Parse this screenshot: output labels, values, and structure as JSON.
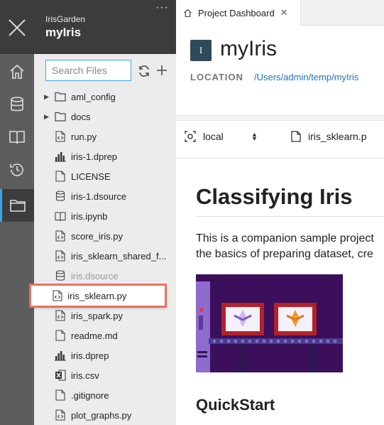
{
  "project": {
    "workspace": "IrisGarden",
    "name": "myIris",
    "more": "···"
  },
  "rail": [
    {
      "name": "home-icon"
    },
    {
      "name": "database-icon"
    },
    {
      "name": "book-icon"
    },
    {
      "name": "history-icon"
    },
    {
      "name": "folder-icon"
    }
  ],
  "files": {
    "search_placeholder": "Search Files",
    "items": [
      {
        "label": "aml_config",
        "type": "folder"
      },
      {
        "label": "docs",
        "type": "folder"
      },
      {
        "label": "run.py",
        "type": "code"
      },
      {
        "label": "iris-1.dprep",
        "type": "dprep"
      },
      {
        "label": "LICENSE",
        "type": "file"
      },
      {
        "label": "iris-1.dsource",
        "type": "db"
      },
      {
        "label": "iris.ipynb",
        "type": "book"
      },
      {
        "label": "score_iris.py",
        "type": "code"
      },
      {
        "label": "iris_sklearn_shared_f...",
        "type": "code"
      },
      {
        "label": "iris.dsource",
        "type": "db"
      },
      {
        "label": "iris_sklearn.py",
        "type": "code"
      },
      {
        "label": "iris_spark.py",
        "type": "code"
      },
      {
        "label": "readme.md",
        "type": "file"
      },
      {
        "label": "iris.dprep",
        "type": "dprep"
      },
      {
        "label": "iris.csv",
        "type": "excel"
      },
      {
        "label": ".gitignore",
        "type": "file"
      },
      {
        "label": "plot_graphs.py",
        "type": "code"
      }
    ]
  },
  "tab": {
    "label": "Project Dashboard"
  },
  "dashboard": {
    "badge": "I",
    "title": "myIris",
    "location_label": "LOCATION",
    "location_path": "/Users/admin/temp/myIris",
    "target": "local",
    "script": "iris_sklearn.p",
    "heading": "Classifying Iris",
    "para_line1": "This is a companion sample project",
    "para_line2": "the basics of preparing dataset, cre",
    "subheading": "QuickStart"
  }
}
